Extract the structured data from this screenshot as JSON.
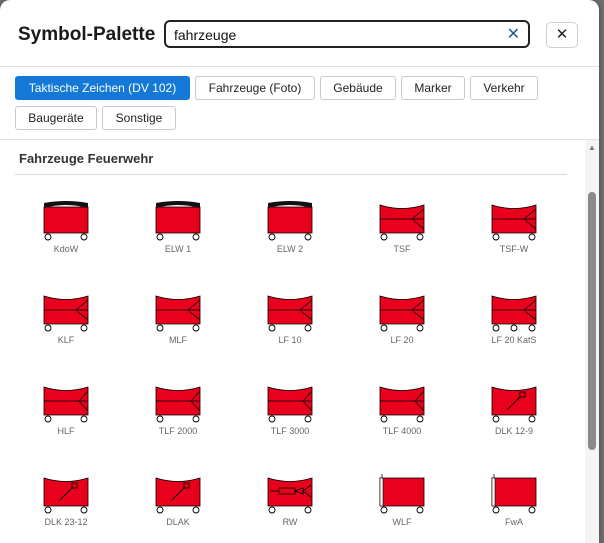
{
  "dialog": {
    "title": "Symbol-Palette",
    "search": {
      "value": "fahrzeuge",
      "clear_label": "✕"
    },
    "close_label": "✕"
  },
  "tabs": [
    {
      "label": "Taktische Zeichen (DV 102)",
      "active": true
    },
    {
      "label": "Fahrzeuge (Foto)",
      "active": false
    },
    {
      "label": "Gebäude",
      "active": false
    },
    {
      "label": "Marker",
      "active": false
    },
    {
      "label": "Verkehr",
      "active": false
    },
    {
      "label": "Baugeräte",
      "active": false
    },
    {
      "label": "Sonstige",
      "active": false
    }
  ],
  "section": {
    "title": "Fahrzeuge Feuerwehr"
  },
  "colors": {
    "symbol_fill": "#e8001c",
    "tab_active": "#1479d6"
  },
  "symbols": [
    {
      "label": "KdoW",
      "variant": "command"
    },
    {
      "label": "ELW 1",
      "variant": "command"
    },
    {
      "label": "ELW 2",
      "variant": "command"
    },
    {
      "label": "TSF",
      "variant": "pump"
    },
    {
      "label": "TSF-W",
      "variant": "pump"
    },
    {
      "label": "KLF",
      "variant": "pump"
    },
    {
      "label": "MLF",
      "variant": "pump"
    },
    {
      "label": "LF 10",
      "variant": "pump"
    },
    {
      "label": "LF 20",
      "variant": "pump"
    },
    {
      "label": "LF 20 KatS",
      "variant": "pump3"
    },
    {
      "label": "HLF",
      "variant": "tanker"
    },
    {
      "label": "TLF 2000",
      "variant": "tanker"
    },
    {
      "label": "TLF 3000",
      "variant": "tanker"
    },
    {
      "label": "TLF 4000",
      "variant": "tanker"
    },
    {
      "label": "DLK 12-9",
      "variant": "ladder"
    },
    {
      "label": "DLK 23-12",
      "variant": "ladder"
    },
    {
      "label": "DLAK",
      "variant": "ladder"
    },
    {
      "label": "RW",
      "variant": "rescue"
    },
    {
      "label": "WLF",
      "variant": "flag"
    },
    {
      "label": "FwA",
      "variant": "flag"
    }
  ]
}
